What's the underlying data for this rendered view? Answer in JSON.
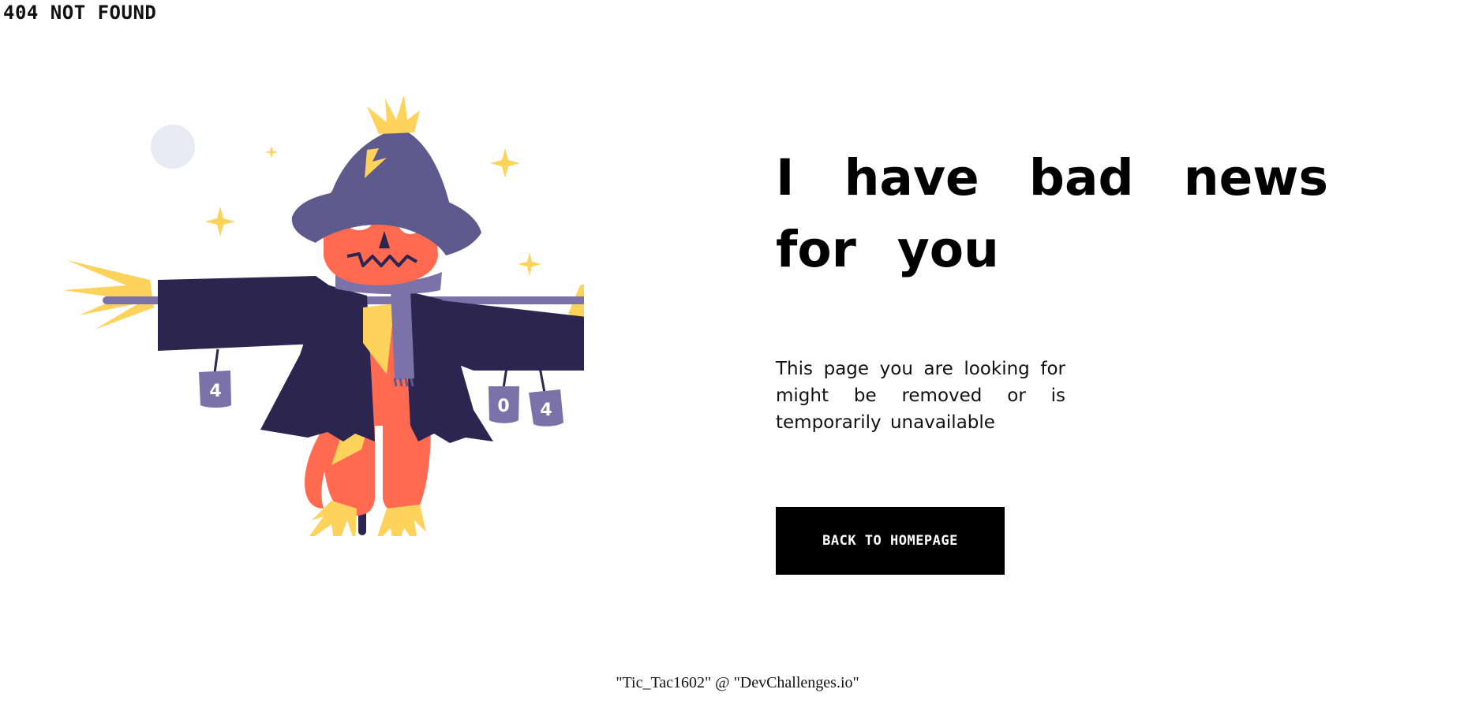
{
  "page": {
    "title": "404 NOT FOUND"
  },
  "hero": {
    "headline": "I have bad news for you",
    "message": "This page you are looking for might be removed or is temporarily unavailable",
    "button_label": "BACK TO HOMEPAGE"
  },
  "illustration": {
    "subject": "scarecrow",
    "can_labels": [
      "4",
      "0",
      "4"
    ]
  },
  "footer": {
    "credit": "\"Tic_Tac1602\" @ \"DevChallenges.io\""
  },
  "colors": {
    "background": "#ffffff",
    "text": "#000000",
    "button_bg": "#000000",
    "button_text": "#ffffff",
    "hat": "#5e5a8e",
    "coat": "#2b2550",
    "body": "#ff6a50",
    "straw": "#fdd35c",
    "scarf": "#7a72a8",
    "moon": "#e9ebf4"
  }
}
